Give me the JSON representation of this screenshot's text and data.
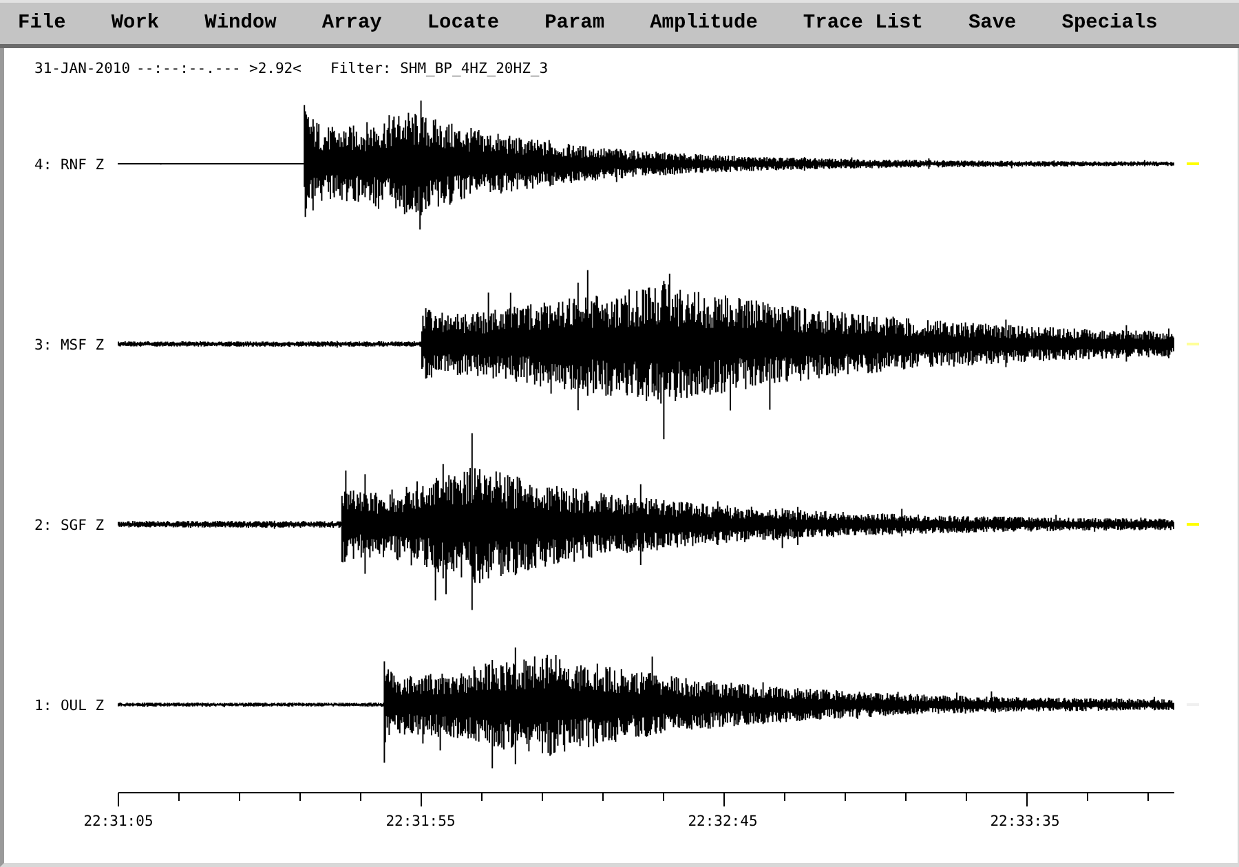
{
  "menu": [
    "File",
    "Work",
    "Window",
    "Array",
    "Locate",
    "Param",
    "Amplitude",
    "Trace List",
    "Save",
    "Specials"
  ],
  "header": {
    "date": "31-JAN-2010",
    "time": "--:--:--.---",
    "threshold": ">2.92<",
    "filter": "Filter: SHM_BP_4HZ_20HZ_3"
  },
  "traces": [
    {
      "label": "4: RNF Z",
      "color": "#ffff00"
    },
    {
      "label": "3: MSF Z",
      "color": "#ffff99"
    },
    {
      "label": "2: SGF Z",
      "color": "#ffff00"
    },
    {
      "label": "1: OUL Z",
      "color": "#f0f0f0"
    }
  ],
  "time_axis": {
    "labels": [
      "22:31:05",
      "22:31:55",
      "22:32:45",
      "22:33:35"
    ]
  }
}
